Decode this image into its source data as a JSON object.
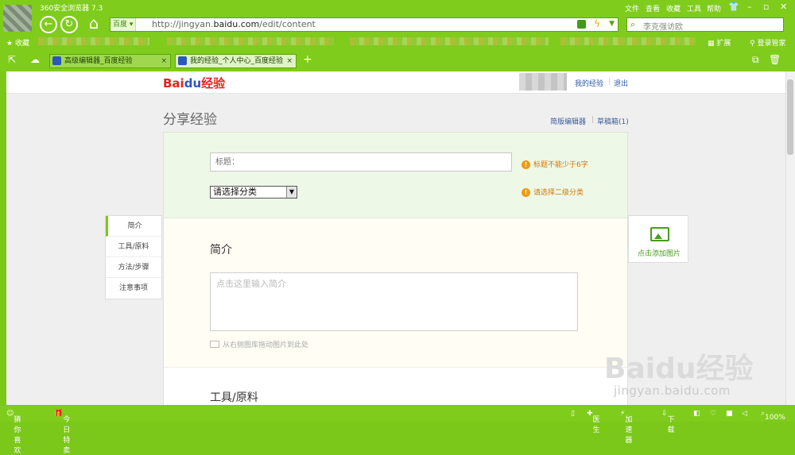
{
  "browser": {
    "title": "360安全浏览器 7.3",
    "url_prefix": "百度 ▾",
    "url_gray": "http://jingyan.",
    "url_bold": "baidu.com",
    "url_tail": "/edit/content",
    "search_placeholder": "李克强访欧",
    "menu": [
      "文件",
      "查看",
      "收藏",
      "工具",
      "帮助"
    ],
    "bookmark_label": "收藏",
    "extensions_label": "扩展",
    "login_label": "登录管家",
    "tabs": [
      {
        "label": "高级编辑器_百度经验",
        "active": false
      },
      {
        "label": "我的经验_个人中心_百度经验",
        "active": true
      }
    ],
    "new_tab": "+"
  },
  "site": {
    "logo_red": "Bai",
    "logo_blue": "du",
    "logo_suffix": "经验",
    "my_exp": "我的经验",
    "logout": "退出",
    "page_title": "分享经验",
    "simple_editor": "简版编辑器",
    "drafts": "草稿箱(1)"
  },
  "form": {
    "title_placeholder": "标题：",
    "title_warning": "标题不能少于6字",
    "category_select": "请选择分类",
    "category_warning": "请选择二级分类",
    "intro_heading": "简介",
    "intro_placeholder": "点击这里输入简介",
    "drag_hint": "从右侧图库拖动图片到此处",
    "tools_heading": "工具/原料"
  },
  "sidenav": [
    "简介",
    "工具/原料",
    "方法/步骤",
    "注意事项"
  ],
  "add_image": "点击添加图片",
  "status": {
    "guess": "猜你喜欢",
    "today": "今日特卖",
    "doctor": "医生",
    "accelerator": "加速器",
    "download": "下载",
    "zoom": "100%"
  },
  "watermark": {
    "main": "Baidu经验",
    "sub": "jingyan.baidu.com"
  },
  "colors": {
    "chrome_green": "#7fcc1c",
    "warning": "#d4760a",
    "link": "#2e5aa3"
  }
}
